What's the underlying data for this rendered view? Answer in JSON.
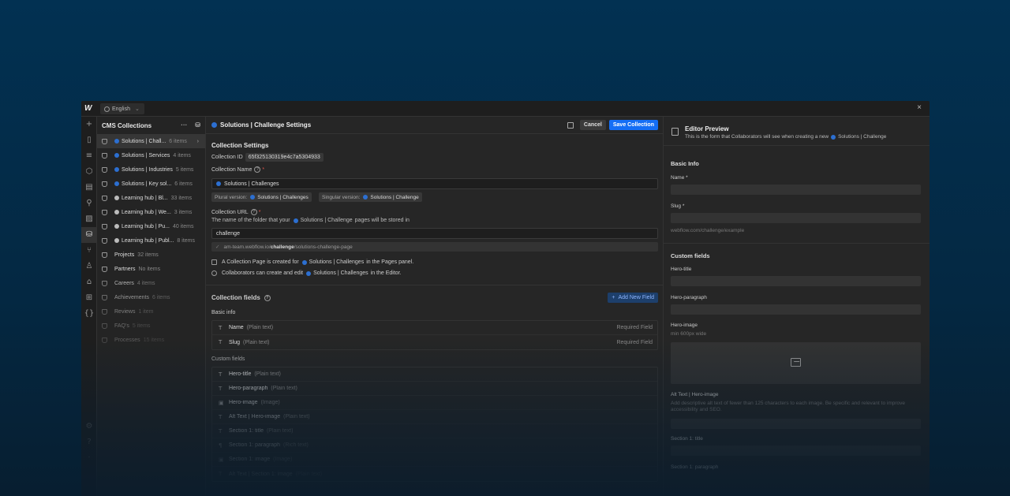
{
  "topbar": {
    "language": "English",
    "close": "×",
    "logo": "W"
  },
  "rail": {
    "icons": [
      "add-icon",
      "pages-icon",
      "navigator-icon",
      "components-icon",
      "styles-icon",
      "variables-icon",
      "assets-icon",
      "cms-icon",
      "logic-icon",
      "users-icon",
      "ecommerce-icon",
      "apps-icon",
      "code-icon"
    ]
  },
  "collections": {
    "title": "CMS Collections",
    "more": "···",
    "items": [
      {
        "name": "Solutions | Chall...",
        "count": "6 items",
        "dot": "#2c6fd1"
      },
      {
        "name": "Solutions | Services",
        "count": "4 items",
        "dot": "#2c6fd1"
      },
      {
        "name": "Solutions | Industries",
        "count": "5 items",
        "dot": "#2c6fd1"
      },
      {
        "name": "Solutions | Key sol...",
        "count": "6 items",
        "dot": "#2c6fd1"
      },
      {
        "name": "Learning hub | Bl...",
        "count": "33 items",
        "dot": "#bbbbbb"
      },
      {
        "name": "Learning hub | We...",
        "count": "3 items",
        "dot": "#bbbbbb"
      },
      {
        "name": "Learning hub | Pu...",
        "count": "40 items",
        "dot": "#bbbbbb"
      },
      {
        "name": "Learning hub | Publ...",
        "count": "8 items",
        "dot": "#bbbbbb"
      },
      {
        "name": "Projects",
        "count": "32 items"
      },
      {
        "name": "Partners",
        "count": "No items"
      },
      {
        "name": "Careers",
        "count": "4 items"
      },
      {
        "name": "Achievements",
        "count": "6 items"
      },
      {
        "name": "Reviews",
        "count": "1 item"
      },
      {
        "name": "FAQ's",
        "count": "5 items"
      },
      {
        "name": "Processes",
        "count": "15 items"
      }
    ]
  },
  "main": {
    "title": "Solutions | Challenge Settings",
    "cancel": "Cancel",
    "save": "Save Collection",
    "settings_title": "Collection Settings",
    "collection_id_label": "Collection ID",
    "collection_id": "65f325130319e4c7a5304933",
    "name_label": "Collection Name",
    "name_value": "Solutions | Challenges",
    "plural_label": "Plural version:",
    "plural_value": "Solutions | Challenges",
    "singular_label": "Singular version:",
    "singular_value": "Solutions | Challenge",
    "url_label": "Collection URL",
    "url_help_pre": "The name of the folder that your",
    "url_help_name": "Solutions | Challenge",
    "url_help_post": "pages will be stored in",
    "url_value": "challenge",
    "url_preview_pre": "am-team.webflow.io/",
    "url_preview_bold": "challenge",
    "url_preview_post": "/solutions-challenge-page",
    "note1_pre": "A Collection Page is created for",
    "note1_name": "Solutions | Challenges",
    "note1_post": "in the Pages panel.",
    "note2_pre": "Collaborators can create and edit",
    "note2_name": "Solutions | Challenges",
    "note2_post": "in the Editor.",
    "fields_title": "Collection fields",
    "add_field": "Add New Field",
    "basic_info": "Basic info",
    "basic_fields": [
      {
        "name": "Name",
        "type": "(Plain text)",
        "req": "Required Field"
      },
      {
        "name": "Slug",
        "type": "(Plain text)",
        "req": "Required Field"
      }
    ],
    "custom_fields_label": "Custom fields",
    "custom_fields": [
      {
        "icon": "T",
        "name": "Hero-title",
        "type": "(Plain text)"
      },
      {
        "icon": "T",
        "name": "Hero-paragraph",
        "type": "(Plain text)"
      },
      {
        "icon": "▣",
        "name": "Hero-image",
        "type": "(Image)"
      },
      {
        "icon": "T",
        "name": "Alt Text | Hero-image",
        "type": "(Plain text)"
      },
      {
        "icon": "T",
        "name": "Section 1: title",
        "type": "(Plain text)"
      },
      {
        "icon": "¶",
        "name": "Section 1: paragraph",
        "type": "(Rich text)"
      },
      {
        "icon": "▣",
        "name": "Section 1: image",
        "type": "(Image)"
      },
      {
        "icon": "T",
        "name": "Alt Text | Section 1: image",
        "type": "(Plain text)"
      }
    ]
  },
  "preview": {
    "title": "Editor Preview",
    "subtitle_pre": "This is the form that Collaborators will see when creating a new",
    "subtitle_name": "Solutions | Challenge",
    "basic_info": "Basic Info",
    "name_label": "Name *",
    "slug_label": "Slug *",
    "slug_hint": "webflow.com/challenge/example",
    "custom_fields": "Custom fields",
    "hero_title": "Hero-title",
    "hero_paragraph": "Hero-paragraph",
    "hero_image": "Hero-image",
    "hero_image_hint": "min 600px wide",
    "alt_label": "Alt Text | Hero-image",
    "alt_hint": "Add descriptive alt text of fewer than 125 characters to each image. Be specific and relevant to improve accessibility and SEO.",
    "section1_title": "Section 1: title",
    "section1_paragraph": "Section 1: paragraph"
  },
  "colors": {
    "accent": "#146ef5",
    "collection_dot": "#2c6fd1",
    "background": "#023152"
  }
}
